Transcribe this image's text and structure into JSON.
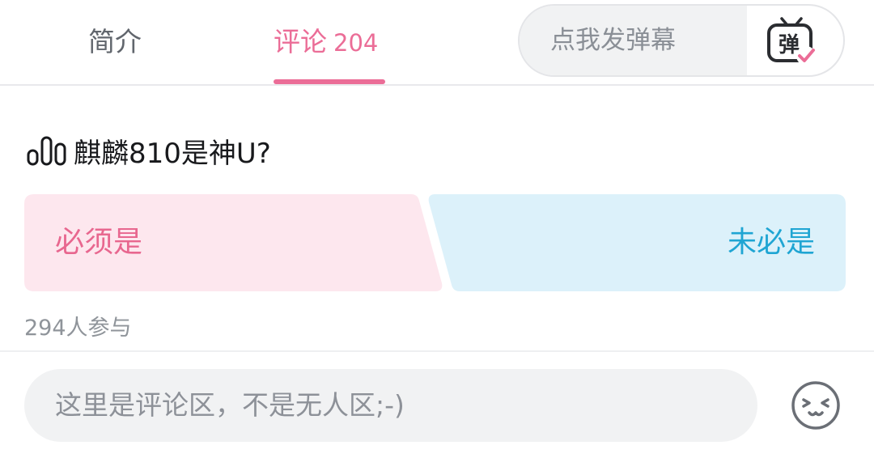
{
  "tabs": {
    "intro_label": "简介",
    "comments_label": "评论",
    "comments_count": "204"
  },
  "danmaku": {
    "placeholder": "点我发弹幕",
    "toggle_glyph": "弹",
    "toggle_icon": "danmaku-tv-icon"
  },
  "vote": {
    "icon": "poll-bars-icon",
    "title": "麒麟810是神U?",
    "option_yes": "必须是",
    "option_no": "未必是",
    "participants": "294人参与"
  },
  "comment_box": {
    "placeholder": "这里是评论区，不是无人区;-)",
    "emoji_icon": "emoji-face-icon"
  },
  "colors": {
    "accent_pink": "#eb6d97",
    "yes_bg": "#fde7ee",
    "yes_text": "#e8678f",
    "no_bg": "#dcf1fa",
    "no_text": "#1fa5d3"
  }
}
